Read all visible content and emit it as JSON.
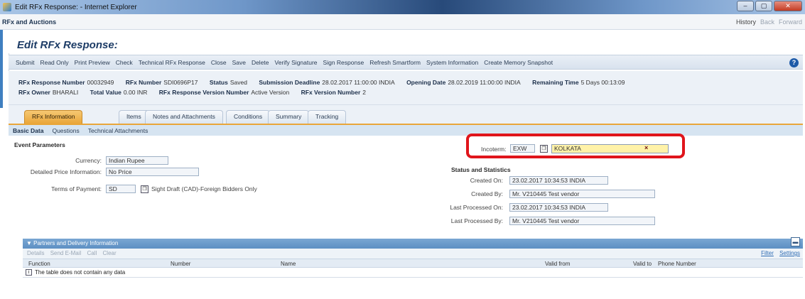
{
  "window": {
    "title": "Edit RFx Response: - Internet Explorer",
    "controls": [
      "–",
      "▢",
      "✕"
    ]
  },
  "portal": {
    "title": "RFx and Auctions",
    "history": "History",
    "back": "Back",
    "forward": "Forward"
  },
  "page": {
    "title": "Edit RFx Response:"
  },
  "toolbar": [
    "Submit",
    "Read Only",
    "Print Preview",
    "Check",
    "Technical RFx Response",
    "Close",
    "Save",
    "Delete",
    "Verify Signature",
    "Sign Response",
    "Refresh Smartform",
    "System Information",
    "Create Memory Snapshot"
  ],
  "header": {
    "response_number_label": "RFx Response Number",
    "response_number": "00032949",
    "rfx_number_label": "RFx Number",
    "rfx_number": "SDI0696P17",
    "status_label": "Status",
    "status": "Saved",
    "deadline_label": "Submission Deadline",
    "deadline": "28.02.2017 11:00:00 INDIA",
    "opening_label": "Opening Date",
    "opening": "28.02.2019 11:00:00 INDIA",
    "remaining_label": "Remaining Time",
    "remaining": "5 Days 00:13:09",
    "owner_label": "RFx Owner",
    "owner": "BHARALI",
    "total_label": "Total Value",
    "total": "0.00 INR",
    "resp_version_label": "RFx Response Version Number",
    "resp_version": "Active Version",
    "rfx_version_label": "RFx Version Number",
    "rfx_version": "2"
  },
  "tabs": [
    "RFx Information",
    "Items",
    "Notes and Attachments",
    "Conditions",
    "Summary",
    "Tracking"
  ],
  "subtabs": [
    "Basic Data",
    "Questions",
    "Technical Attachments"
  ],
  "event": {
    "section_title": "Event Parameters",
    "currency_label": "Currency:",
    "currency": "Indian Rupee",
    "price_info_label": "Detailed Price Information:",
    "price_info": "No Price",
    "payment_label": "Terms of Payment:",
    "payment_code": "SD",
    "payment_desc": "Sight Draft (CAD)-Foreign Bidders Only"
  },
  "incoterm": {
    "label": "Incoterm:",
    "code": "EXW",
    "location": "KOLKATA",
    "clear": "×"
  },
  "stats": {
    "section_title": "Status and Statistics",
    "created_on_label": "Created On:",
    "created_on": "23.02.2017 10:34:53 INDIA",
    "created_by_label": "Created By:",
    "created_by": "Mr. V210445 Test vendor",
    "last_processed_on_label": "Last Processed On:",
    "last_processed_on": "23.02.2017 10:34:53 INDIA",
    "last_processed_by_label": "Last Processed By:",
    "last_processed_by": "Mr. V210445 Test vendor"
  },
  "partners": {
    "title": "▼ Partners and Delivery Information",
    "tools": [
      "Details",
      "Send E-Mail",
      "Call",
      "Clear"
    ],
    "filter": "Filter",
    "settings": "Settings",
    "columns": [
      "Function",
      "Number",
      "Name",
      "Valid from",
      "Valid to",
      "Phone Number"
    ],
    "empty_text": "The table does not contain any data"
  }
}
